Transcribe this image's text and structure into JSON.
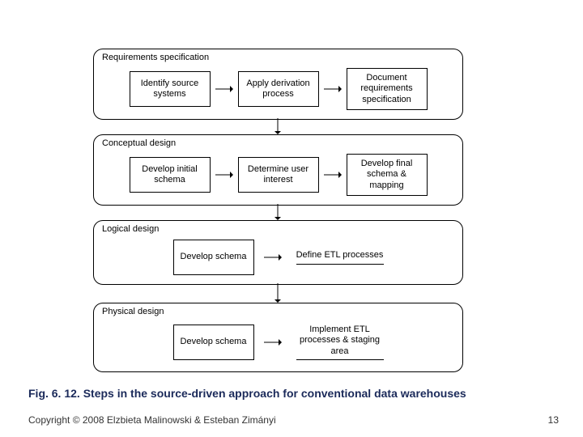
{
  "diagram": {
    "phases": [
      {
        "label": "Requirements specification",
        "steps": [
          "Identify source systems",
          "Apply derivation process",
          "Document requirements specification"
        ],
        "boxedSteps": [
          true,
          true,
          true
        ]
      },
      {
        "label": "Conceptual design",
        "steps": [
          "Develop initial schema",
          "Determine user interest",
          "Develop final schema & mapping"
        ],
        "boxedSteps": [
          true,
          true,
          true
        ]
      },
      {
        "label": "Logical design",
        "steps": [
          "Develop schema",
          "Define ETL processes"
        ],
        "boxedSteps": [
          true,
          false
        ]
      },
      {
        "label": "Physical design",
        "steps": [
          "Develop schema",
          "Implement ETL processes & staging area"
        ],
        "boxedSteps": [
          true,
          false
        ]
      }
    ]
  },
  "caption": "Fig. 6. 12. Steps in the source-driven approach for conventional data warehouses",
  "copyright": "Copyright © 2008 Elzbieta Malinowski & Esteban Zimányi",
  "page": "13"
}
